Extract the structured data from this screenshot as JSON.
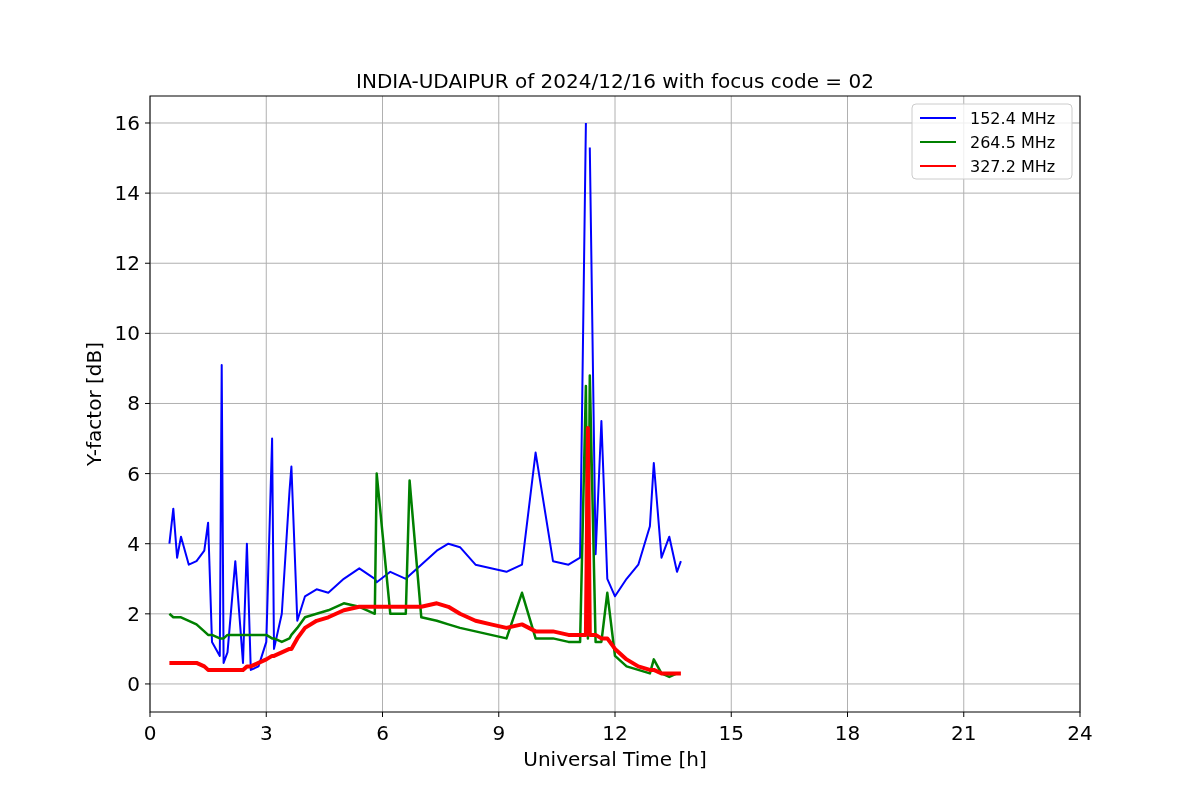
{
  "figure": {
    "chart_data": {
      "type": "line",
      "title": "INDIA-UDAIPUR of 2024/12/16 with focus code = 02",
      "xlabel": "Universal Time [h]",
      "ylabel": "Y-factor [dB]",
      "x": [
        0.5,
        0.6,
        0.7,
        0.8,
        1.0,
        1.2,
        1.4,
        1.5,
        1.6,
        1.8,
        1.85,
        1.9,
        2.0,
        2.2,
        2.4,
        2.5,
        2.6,
        2.8,
        3.0,
        3.15,
        3.2,
        3.4,
        3.6,
        3.65,
        3.8,
        4.0,
        4.3,
        4.6,
        5.0,
        5.4,
        5.8,
        5.85,
        6.2,
        6.6,
        6.7,
        7.0,
        7.4,
        7.7,
        8.0,
        8.4,
        8.8,
        9.2,
        9.6,
        9.95,
        10.4,
        10.8,
        11.1,
        11.25,
        11.3,
        11.35,
        11.5,
        11.65,
        11.8,
        12.0,
        12.3,
        12.6,
        12.9,
        13.0,
        13.2,
        13.4,
        13.6,
        13.7
      ],
      "series": [
        {
          "name": "152.4 MHz",
          "color": "#0000ff",
          "values": [
            4.0,
            5.0,
            3.6,
            4.2,
            3.4,
            3.5,
            3.8,
            4.6,
            1.2,
            0.8,
            9.1,
            0.6,
            0.9,
            3.5,
            0.6,
            4.0,
            0.4,
            0.5,
            1.2,
            7.0,
            1.0,
            2.0,
            5.5,
            6.2,
            1.8,
            2.5,
            2.7,
            2.6,
            3.0,
            3.3,
            3.0,
            2.9,
            3.2,
            3.0,
            3.1,
            3.4,
            3.8,
            4.0,
            3.9,
            3.4,
            3.3,
            3.2,
            3.4,
            6.6,
            3.5,
            3.4,
            3.6,
            16.0,
            null,
            15.3,
            3.7,
            7.5,
            3.0,
            2.5,
            3.0,
            3.4,
            4.5,
            6.3,
            3.6,
            4.2,
            3.2,
            3.5
          ]
        },
        {
          "name": "264.5 MHz",
          "color": "#008000",
          "values": [
            2.0,
            1.9,
            1.9,
            1.9,
            1.8,
            1.7,
            1.5,
            1.4,
            1.4,
            1.3,
            1.3,
            1.3,
            1.4,
            1.4,
            1.4,
            1.4,
            1.4,
            1.4,
            1.4,
            1.3,
            1.3,
            1.2,
            1.3,
            1.4,
            1.6,
            1.9,
            2.0,
            2.1,
            2.3,
            2.2,
            2.0,
            6.0,
            2.0,
            2.0,
            5.8,
            1.9,
            1.8,
            1.7,
            1.6,
            1.5,
            1.4,
            1.3,
            2.6,
            1.3,
            1.3,
            1.2,
            1.2,
            8.5,
            1.3,
            8.8,
            1.2,
            1.2,
            2.6,
            0.8,
            0.5,
            0.4,
            0.3,
            0.7,
            0.3,
            0.2,
            0.3,
            null
          ]
        },
        {
          "name": "327.2 MHz",
          "color": "#ff0000",
          "values": [
            0.6,
            0.6,
            0.6,
            0.6,
            0.6,
            0.6,
            0.5,
            0.4,
            0.4,
            0.4,
            0.4,
            0.4,
            0.4,
            0.4,
            0.4,
            0.5,
            0.5,
            0.6,
            0.7,
            0.8,
            0.8,
            0.9,
            1.0,
            1.0,
            1.3,
            1.6,
            1.8,
            1.9,
            2.1,
            2.2,
            2.2,
            2.2,
            2.2,
            2.2,
            2.2,
            2.2,
            2.3,
            2.2,
            2.0,
            1.8,
            1.7,
            1.6,
            1.7,
            1.5,
            1.5,
            1.4,
            1.4,
            1.4,
            7.3,
            1.4,
            1.4,
            1.3,
            1.3,
            1.0,
            0.7,
            0.5,
            0.4,
            0.4,
            0.3,
            0.3,
            0.3,
            0.3
          ]
        }
      ],
      "grid": true,
      "legend": true,
      "xlim": [
        0,
        24
      ],
      "ylim": [
        -0.8,
        16.77
      ],
      "xticks": [
        0,
        3,
        6,
        9,
        12,
        15,
        18,
        21,
        24
      ],
      "yticks": [
        0,
        2,
        4,
        6,
        8,
        10,
        12,
        14,
        16
      ]
    }
  }
}
